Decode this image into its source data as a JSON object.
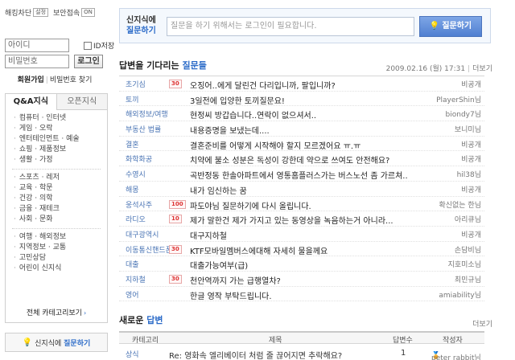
{
  "login": {
    "hacking_block_label": "해킹차단",
    "hacking_block_badge": "설정",
    "security_label": "보안접속",
    "security_badge": "ON",
    "id_placeholder": "아이디",
    "pw_placeholder": "비밀번호",
    "ip_check_label": "ID저장",
    "login_button": "로그인",
    "join_link": "회원가입",
    "find_pw_link": "비밀번호 찾기"
  },
  "category_tabs": {
    "qa_tab": "Q&A지식",
    "open_tab": "오픈지식"
  },
  "categories": {
    "group1": [
      "컴퓨터 · 인터넷",
      "게임 · 오락",
      "엔터테인먼트 · 예술",
      "쇼핑 · 제품정보",
      "생활 · 가정"
    ],
    "group2": [
      "스포츠 · 레저",
      "교육 · 학문",
      "건강 · 의학",
      "금융 · 재테크",
      "사회 · 문화"
    ],
    "group3": [
      "여행 · 해외정보",
      "지역정보 · 교통",
      "고민상담",
      "어린이 신지식"
    ],
    "all_categories": "전체 카테고리보기",
    "all_arrow": "›"
  },
  "ask_side": {
    "prefix": "신지식에",
    "action": "질문하기"
  },
  "ask_bar": {
    "title_line1": "신지식에",
    "title_line2": "질문하기",
    "input_placeholder": "질문을 하기 위해서는 로그인이 필요합니다.",
    "button": "질문하기"
  },
  "waiting": {
    "title_prefix": "답변을 기다리는",
    "title_highlight": "질문들",
    "date": "2009.02.16 (월) 17:31",
    "more": "더보기",
    "rows": [
      {
        "cat": "초기심",
        "pts": "30",
        "title": "오징어..에게 달린건 다리입니까, 팔입니까?",
        "who": "비공개"
      },
      {
        "cat": "토끼",
        "pts": "",
        "title": "3일전에 입양한 토끼질문요!",
        "who": "PlayerShin님"
      },
      {
        "cat": "해외정보/여행",
        "pts": "",
        "title": "현정씨 방갑습니다..연락이 없으셔서..",
        "who": "biondy7님"
      },
      {
        "cat": "부동산 법률",
        "pts": "",
        "title": "내용증명을 보냈는데....",
        "who": "보니미님"
      },
      {
        "cat": "결혼",
        "pts": "",
        "title": "결혼준비를 어떻게 시작해야 할지 모르겠어요 ㅠ.ㅠ",
        "who": "비공개"
      },
      {
        "cat": "화학화공",
        "pts": "",
        "title": "치약에 불소 성분은 독성이 강한데 약으로 쓰여도 안전해요?",
        "who": "비공개"
      },
      {
        "cat": "수영시",
        "pts": "",
        "title": "곡반정동 한솔아파트에서 영통홈플러스가는 버스노선 좀 가르쳐..",
        "who": "hil38님"
      },
      {
        "cat": "해몽",
        "pts": "",
        "title": "내가 임신하는 꿈",
        "who": "비공개"
      },
      {
        "cat": "웅석사주",
        "pts": "100",
        "title": "파도야님 질문하기에 다시 올립니다.",
        "who": "확신없는 한님"
      },
      {
        "cat": "라디오",
        "pts": "10",
        "title": "제가 말한건 제가 가지고 있는 동영상을 녹음하는거 아니라...",
        "who": "아리큐님"
      },
      {
        "cat": "대구광역시",
        "pts": "",
        "title": "대구지하철",
        "who": "비공개"
      },
      {
        "cat": "이동통신핸드폰",
        "pts": "30",
        "title": "KTF모바일멤버스에대해 자세히 물을께요",
        "who": "손담비님"
      },
      {
        "cat": "대출",
        "pts": "",
        "title": "대출가능여부(급)",
        "who": "지호미소님"
      },
      {
        "cat": "지하철",
        "pts": "30",
        "title": "천안역까지 가는 급행열차?",
        "who": "최민규님"
      },
      {
        "cat": "영어",
        "pts": "",
        "title": "한글 영작 부탁드립니다.",
        "who": "amiability님"
      }
    ]
  },
  "new_answers": {
    "title_prefix": "새로운",
    "title_highlight": "답변",
    "more": "더보기",
    "headers": [
      "카테고리",
      "제목",
      "답변수",
      "작성자"
    ],
    "row": {
      "cat": "상식",
      "title": "Re: 영화속 엘리베이터 처럼 줄 끊어지면 추락해요?",
      "count": "1",
      "who": "peter rabbit님"
    }
  }
}
